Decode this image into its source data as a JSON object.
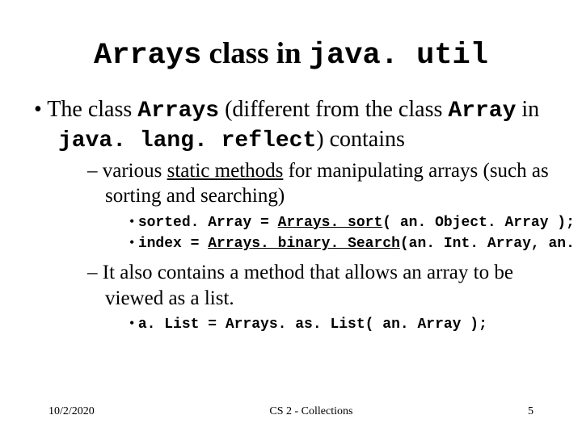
{
  "title": {
    "part1_mono": "Arrays",
    "part2": " class in ",
    "part3_mono": "java. util"
  },
  "bullet1": {
    "t1": "The class ",
    "t2_mono": "Arrays",
    "t3": "  (different from the class ",
    "t4_mono": "Array",
    "t5": " in ",
    "t6_mono": "java. lang. reflect",
    "t7": ") contains"
  },
  "sub1": {
    "t1": "various ",
    "t2_u": "static methods",
    "t3": " for manipulating arrays (such as sorting and searching)"
  },
  "code1a": {
    "t1": "sorted. Array = ",
    "t2_u": "Arrays. sort",
    "t3": "( an. Object. Array );"
  },
  "code1b": {
    "t1": "index = ",
    "t2_u": "Arrays. binary. Search",
    "t3": "(an. Int. Array, an. Int);"
  },
  "sub2": {
    "t1": "It also contains a method that allows an array to be viewed as a list."
  },
  "code2": {
    "t1": "a. List = Arrays. as. List( an. Array );"
  },
  "footer": {
    "date": "10/2/2020",
    "center": "CS 2 - Collections",
    "page": "5"
  }
}
